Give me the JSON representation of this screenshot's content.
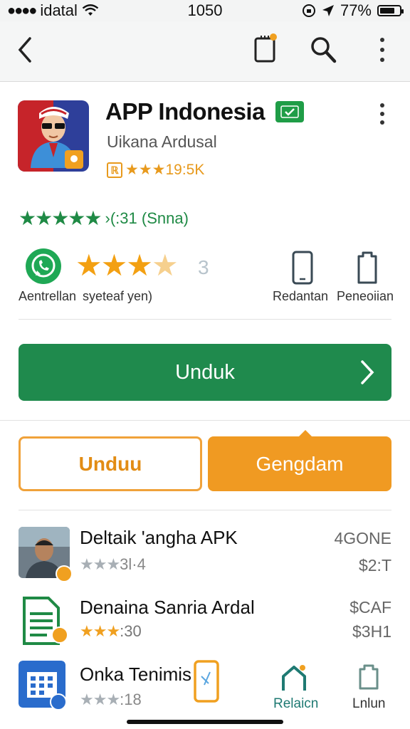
{
  "status_bar": {
    "carrier": "idatal",
    "time": "1050",
    "battery": "77%",
    "battery_level": 0.77
  },
  "nav": {
    "icons": [
      "back-icon",
      "clipboard-icon",
      "search-icon",
      "more-vert-icon"
    ]
  },
  "app": {
    "title": "APP Indonesia",
    "developer": "Uikana Ardusal",
    "meta": "★★★19:5K",
    "meta_badge": "ℝ",
    "rating_stars": "★★★★★",
    "rating_text": "›(:31 (Snna)",
    "big_rating_number": "3"
  },
  "feature_row": {
    "caption_left": "Aentrellan",
    "caption_mid": "syeteaf yen)",
    "caption_phone": "Redantan",
    "caption_clip": "Peneoiian"
  },
  "buttons": {
    "main": "Unduk",
    "outline": "Unduu",
    "filled": "Gengdam"
  },
  "list": [
    {
      "title": "Deltaik ʹangha APK",
      "rating": "3l·4",
      "right_top": "4GONE",
      "right_bottom": "$2:T"
    },
    {
      "title": "Denaina Sanria Ardal",
      "rating": ":30",
      "right_top": "$CAF",
      "right_bottom": "$3H1"
    },
    {
      "title": "Onka Tenimis",
      "rating": ":18"
    }
  ],
  "bottom_nav": {
    "item1": "Relaicn",
    "item2": "Lnlun"
  },
  "colors": {
    "green": "#1f8a4d",
    "orange": "#f09a22",
    "star_orange": "#f3a012"
  }
}
